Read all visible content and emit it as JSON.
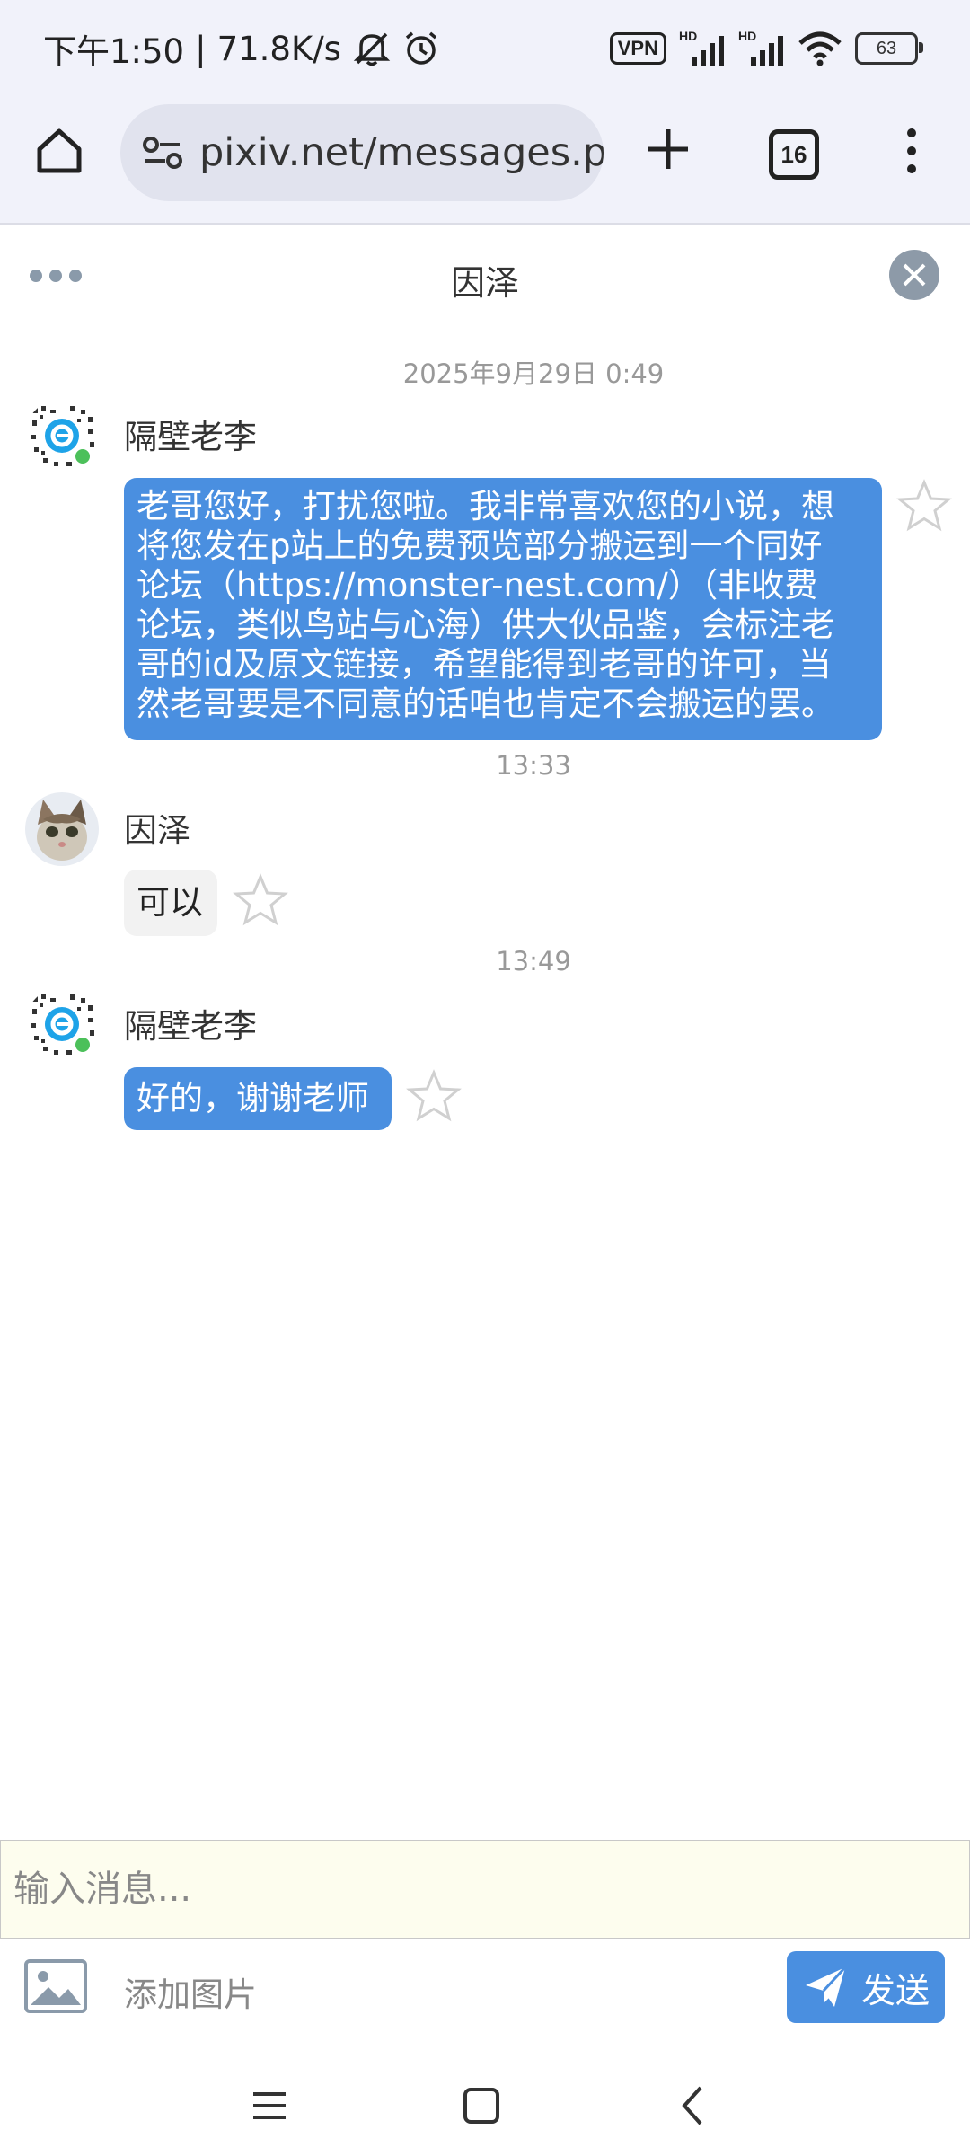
{
  "status_bar": {
    "time": "下午1:50",
    "separator": "|",
    "speed": "71.8K/s",
    "vpn": "VPN",
    "hd1": "HD",
    "hd2": "HD",
    "battery": "63"
  },
  "browser": {
    "url": "pixiv.net/messages.php",
    "tab_count": "16"
  },
  "chat": {
    "title": "因泽",
    "messages": [
      {
        "timestamp": "2025年9月29日 0:49",
        "sender": "隔壁老李",
        "lines": [
          "老哥您好，打扰您啦。我非常喜欢您的小说，想",
          "将您发在p站上的免费预览部分搬运到一个同好",
          "论坛（https://monster-nest.com/）（非收费",
          "论坛，类似鸟站与心海）供大伙品鉴，会标注老",
          "哥的id及原文链接，希望能得到老哥的许可，当",
          "然老哥要是不同意的话咱也肯定不会搬运的罢。"
        ]
      },
      {
        "timestamp": "13:33",
        "sender": "因泽",
        "text": "可以"
      },
      {
        "timestamp": "13:49",
        "sender": "隔壁老李",
        "text": "好的，谢谢老师"
      }
    ]
  },
  "composer": {
    "placeholder": "输入消息...",
    "add_image_label": "添加图片",
    "send_label": "发送"
  },
  "colors": {
    "accent": "#4a8fe0",
    "input_bg": "#fdfdee",
    "close_button": "#8d9aa8"
  }
}
